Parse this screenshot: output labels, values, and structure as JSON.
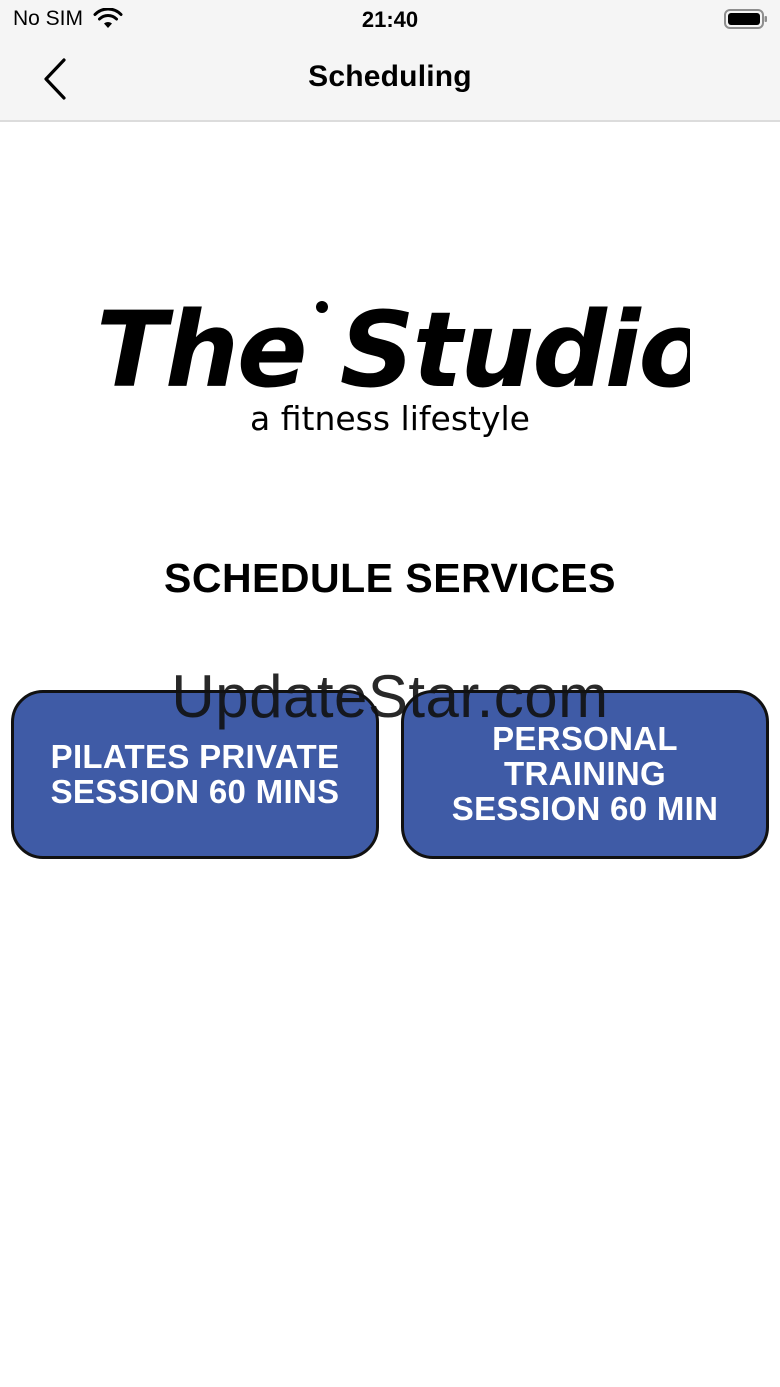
{
  "status_bar": {
    "carrier": "No SIM",
    "time": "21:40",
    "wifi_icon": "wifi-icon",
    "battery_icon": "battery-icon"
  },
  "nav_bar": {
    "back_icon": "chevron-left-icon",
    "title": "Scheduling"
  },
  "logo": {
    "wordmark": "The Studio",
    "tagline": "a fitness lifestyle"
  },
  "main": {
    "heading": "SCHEDULE SERVICES",
    "services": [
      {
        "label": "PILATES PRIVATE\nSESSION 60 MINS"
      },
      {
        "label": "PERSONAL\nTRAINING\nSESSION 60 MIN"
      }
    ],
    "button_color": "#3f5ba6"
  },
  "watermark": "UpdateStar.com"
}
